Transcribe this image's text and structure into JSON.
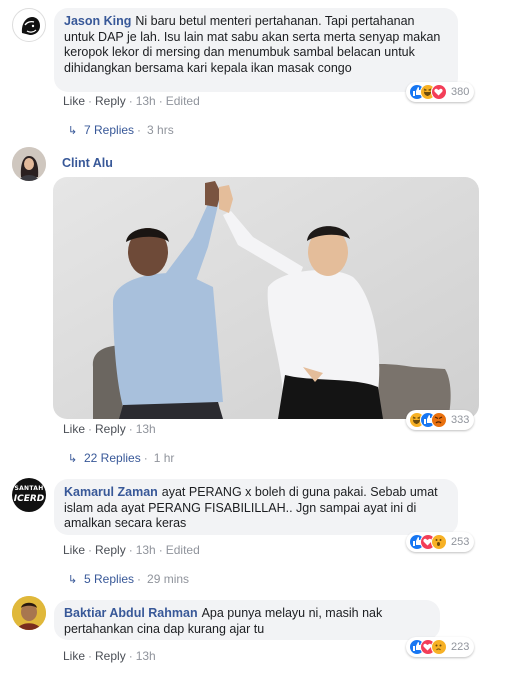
{
  "comments": [
    {
      "author": "Jason King",
      "text": "Ni baru betul menteri pertahanan. Tapi pertahanan untuk DAP je lah. Isu lain mat sabu akan serta merta senyap makan keropok lekor di mersing dan menumbuk sambal belacan untuk dihidangkan bersama kari kepala ikan masak congo",
      "like": "Like",
      "reply": "Reply",
      "time": "13h",
      "edited": "Edited",
      "reaction_count": "380",
      "reactions": [
        "like",
        "haha",
        "love"
      ],
      "replies": "7 Replies",
      "replies_time": "3 hrs"
    },
    {
      "author": "Clint Alu",
      "text": "",
      "like": "Like",
      "reply": "Reply",
      "time": "13h",
      "edited": "",
      "reaction_count": "333",
      "reactions": [
        "haha",
        "like",
        "angry"
      ],
      "replies": "22 Replies",
      "replies_time": "1 hr"
    },
    {
      "author": "Kamarul Zaman",
      "avatar_text": [
        "SANTAH",
        "ICERD"
      ],
      "text": "ayat PERANG x boleh di guna pakai. Sebab umat islam ada ayat PERANG FISABILILLAH.. Jgn sampai ayat ini di amalkan secara keras",
      "like": "Like",
      "reply": "Reply",
      "time": "13h",
      "edited": "Edited",
      "reaction_count": "253",
      "reactions": [
        "like",
        "love",
        "wow"
      ],
      "replies": "5 Replies",
      "replies_time": "29 mins"
    },
    {
      "author": "Baktiar Abdul Rahman",
      "text": "Apa punya melayu ni, masih nak pertahankan cina dap kurang ajar tu",
      "like": "Like",
      "reply": "Reply",
      "time": "13h",
      "edited": "",
      "reaction_count": "223",
      "reactions": [
        "like",
        "love",
        "sad"
      ]
    }
  ],
  "colors": {
    "link": "#385898",
    "bubble": "#f2f3f5",
    "like": "#1877f2",
    "love": "#f33e58",
    "haha": "#f7b125"
  }
}
